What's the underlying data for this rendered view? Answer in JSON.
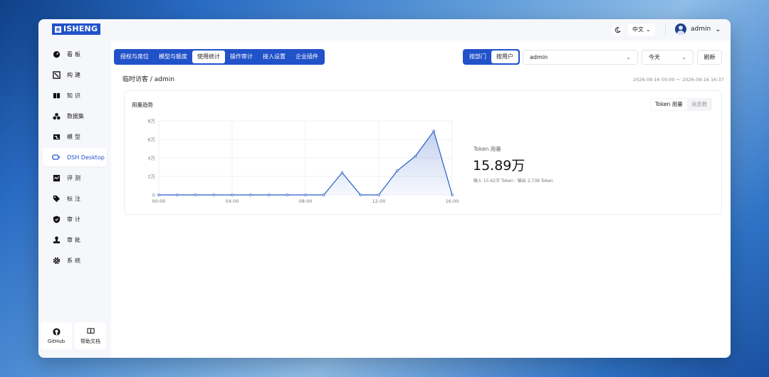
{
  "app": {
    "logo_text": "ISHENG"
  },
  "header": {
    "language": "中文",
    "username": "admin"
  },
  "sidebar": {
    "items": [
      {
        "label": "看板",
        "icon": "dashboard-icon"
      },
      {
        "label": "构建",
        "icon": "build-icon"
      },
      {
        "label": "知识",
        "icon": "book-icon"
      },
      {
        "label": "数据集",
        "icon": "dataset-icon"
      },
      {
        "label": "模型",
        "icon": "model-icon"
      },
      {
        "label": "DSH Desktop",
        "icon": "desktop-icon"
      },
      {
        "label": "评测",
        "icon": "evaluation-icon"
      },
      {
        "label": "标注",
        "icon": "tag-icon"
      },
      {
        "label": "审计",
        "icon": "shield-icon"
      },
      {
        "label": "审批",
        "icon": "stamp-icon"
      },
      {
        "label": "系统",
        "icon": "gear-icon"
      }
    ],
    "github_label": "GitHub",
    "docs_label": "帮助文档"
  },
  "tabs": [
    "授权与席位",
    "模型与额度",
    "使用统计",
    "操作审计",
    "接入设置",
    "企业插件"
  ],
  "active_tab": "使用统计",
  "group_by": [
    "按部门",
    "按用户"
  ],
  "filters": {
    "user": "admin",
    "period": "今天",
    "refresh_label": "刷新"
  },
  "breadcrumb": "临时访客 / admin",
  "date_range": "2026-09-16 00:00 ～ 2026-09-16 16:37",
  "usage_card": {
    "title": "用量趋势",
    "metric_options": [
      "Token 用量",
      "消息数"
    ],
    "stat_label": "Token 用量",
    "stat_value": "15.89万",
    "stat_breakdown": "输入 15.62万 Token · 输出 2,738 Token"
  },
  "chart_data": {
    "type": "area",
    "x": [
      "00:00",
      "01:00",
      "02:00",
      "03:00",
      "04:00",
      "05:00",
      "06:00",
      "07:00",
      "08:00",
      "09:00",
      "10:00",
      "11:00",
      "12:00",
      "13:00",
      "14:00",
      "15:00",
      "16:00"
    ],
    "x_tick_labels": [
      "00:00",
      "04:00",
      "08:00",
      "12:00",
      "16:00"
    ],
    "y_tick_labels": [
      "0",
      "2万",
      "4万",
      "6万",
      "8万"
    ],
    "values": [
      0,
      0,
      0,
      0,
      0,
      0,
      0,
      0,
      0,
      0,
      24000,
      0,
      0,
      26000,
      42000,
      69000,
      0
    ],
    "ylim": [
      0,
      80000
    ],
    "grid": true,
    "line_color": "#2a5cc8",
    "fill_color": "#dfe6f8"
  },
  "colors": {
    "accent": "#2152c9"
  }
}
